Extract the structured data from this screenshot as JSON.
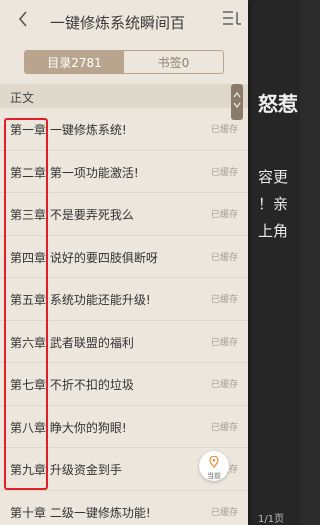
{
  "drawer": {
    "book_title": "一键修炼系统瞬间百",
    "menu_label": "三↓",
    "tabs": [
      {
        "label": "目录2781",
        "active": true
      },
      {
        "label": "书签0",
        "active": false
      }
    ],
    "section_label": "正文",
    "locate_label": "当前",
    "chapters": [
      {
        "title": "第一章  一键修炼系统!",
        "status": "已缓存"
      },
      {
        "title": "第二章  第一项功能激活!",
        "status": "已缓存"
      },
      {
        "title": "第三章  不是要弄死我么",
        "status": "已缓存"
      },
      {
        "title": "第四章  说好的要四肢俱断呀",
        "status": "已缓存"
      },
      {
        "title": "第五章  系统功能还能升级!",
        "status": "已缓存"
      },
      {
        "title": "第六章  武者联盟的福利",
        "status": "已缓存"
      },
      {
        "title": "第七章  不折不扣的垃圾",
        "status": "已缓存"
      },
      {
        "title": "第八章  睁大你的狗眼!",
        "status": "已缓存"
      },
      {
        "title": "第九章  升级资金到手",
        "status": "已缓存"
      },
      {
        "title": "第十章  二级一键修炼功能!",
        "status": "已缓存"
      }
    ]
  },
  "reader": {
    "title_fragment": "怒惹",
    "lines": [
      "容更",
      "！亲",
      "上角"
    ],
    "page_indicator": "1/1页"
  },
  "colors": {
    "drawer_bg": "#ece6dd",
    "tab_active": "#b9a58e",
    "highlight": "#e11d2a",
    "reader_bg": "#262626"
  },
  "icons": {
    "back": "chevron-left-icon",
    "menu": "list-icon",
    "locate": "map-pin-icon",
    "scroll": "scroll-handle-icon"
  }
}
